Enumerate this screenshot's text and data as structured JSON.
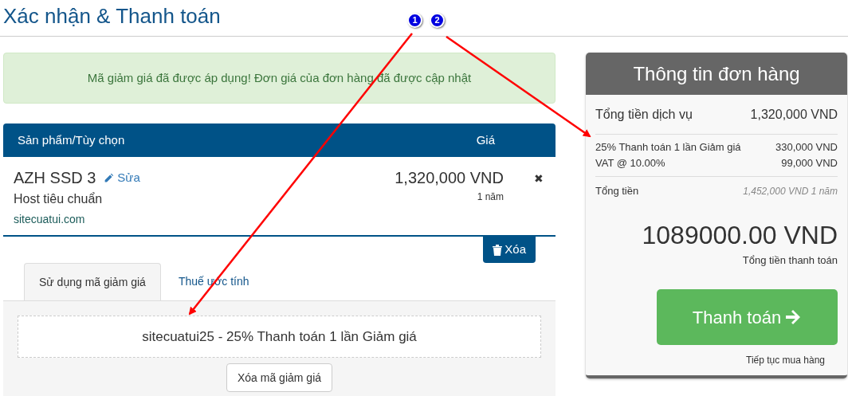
{
  "page_title": "Xác nhận & Thanh toán",
  "alert": "Mã giảm giá đã được áp dụng! Đơn giá của đơn hàng đã được cập nhật",
  "cart": {
    "columns": [
      "Sản phẩm/Tùy chọn",
      "Giá"
    ],
    "items": [
      {
        "name": "AZH SSD 3",
        "edit_label": "Sửa",
        "group": "Host tiêu chuẩn",
        "domain": "sitecuatui.com",
        "price": "1,320,000 VND",
        "cycle": "1 năm",
        "remove_icon": "✖"
      }
    ],
    "clear_button": "Xóa"
  },
  "tabs": [
    {
      "label": "Sử dụng mã giảm giá",
      "selected": true
    },
    {
      "label": "Thuế ước tính",
      "selected": false
    }
  ],
  "promo": {
    "applied": "sitecuatui25 - 25% Thanh toán 1 lần Giảm giá",
    "remove_button": "Xóa mã giảm giá"
  },
  "summary": {
    "title": "Thông tin đơn hàng",
    "subtotal": {
      "label": "Tổng tiền dịch vụ",
      "value": "1,320,000 VND"
    },
    "adjustments": [
      {
        "label": "25% Thanh toán 1 lần Giảm giá",
        "value": "330,000 VND"
      },
      {
        "label": "VAT @ 10.00%",
        "value": "99,000 VND"
      }
    ],
    "recurring": {
      "label": "Tổng tiền",
      "value": "1,452,000 VND 1 năm"
    },
    "total": "1089000.00 VND",
    "total_label": "Tổng tiền thanh toán",
    "checkout_button": "Thanh toán",
    "continue_link": "Tiếp tục mua hàng"
  },
  "annotations": [
    {
      "label": "1"
    },
    {
      "label": "2"
    }
  ]
}
